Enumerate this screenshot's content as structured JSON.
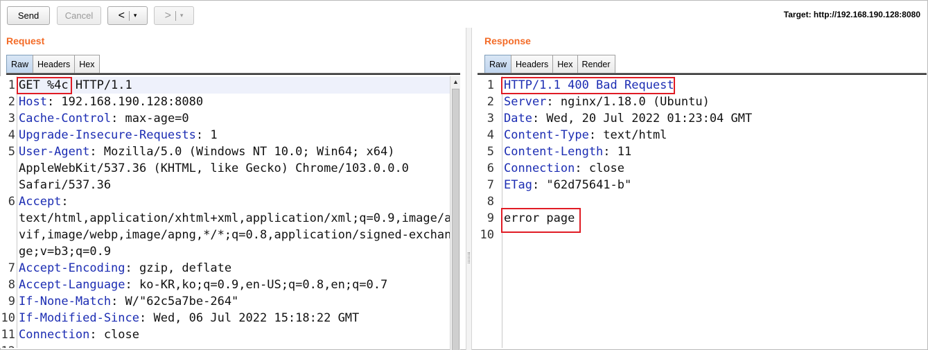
{
  "toolbar": {
    "send_label": "Send",
    "cancel_label": "Cancel",
    "back_label": "<",
    "forward_label": ">",
    "dropdown_glyph": "▾",
    "target_label": "Target: http://192.168.190.128:8080"
  },
  "request": {
    "title": "Request",
    "tabs": [
      "Raw",
      "Headers",
      "Hex"
    ],
    "active_tab": "Raw",
    "lines": [
      {
        "n": "1",
        "parts": [
          [
            "hv",
            "GET %4c HTTP/1.1"
          ]
        ]
      },
      {
        "n": "2",
        "parts": [
          [
            "hk",
            "Host"
          ],
          [
            "hv",
            ": 192.168.190.128:8080"
          ]
        ]
      },
      {
        "n": "3",
        "parts": [
          [
            "hk",
            "Cache-Control"
          ],
          [
            "hv",
            ": max-age=0"
          ]
        ]
      },
      {
        "n": "4",
        "parts": [
          [
            "hk",
            "Upgrade-Insecure-Requests"
          ],
          [
            "hv",
            ": 1"
          ]
        ]
      },
      {
        "n": "5",
        "parts": [
          [
            "hk",
            "User-Agent"
          ],
          [
            "hv",
            ": Mozilla/5.0 (Windows NT 10.0; Win64; x64)"
          ]
        ]
      },
      {
        "n": "",
        "parts": [
          [
            "hv",
            "AppleWebKit/537.36 (KHTML, like Gecko) Chrome/103.0.0.0"
          ]
        ]
      },
      {
        "n": "",
        "parts": [
          [
            "hv",
            "Safari/537.36"
          ]
        ]
      },
      {
        "n": "6",
        "parts": [
          [
            "hk",
            "Accept"
          ],
          [
            "hv",
            ":"
          ]
        ]
      },
      {
        "n": "",
        "parts": [
          [
            "hv",
            "text/html,application/xhtml+xml,application/xml;q=0.9,image/a"
          ]
        ]
      },
      {
        "n": "",
        "parts": [
          [
            "hv",
            "vif,image/webp,image/apng,*/*;q=0.8,application/signed-exchan"
          ]
        ]
      },
      {
        "n": "",
        "parts": [
          [
            "hv",
            "ge;v=b3;q=0.9"
          ]
        ]
      },
      {
        "n": "7",
        "parts": [
          [
            "hk",
            "Accept-Encoding"
          ],
          [
            "hv",
            ": gzip, deflate"
          ]
        ]
      },
      {
        "n": "8",
        "parts": [
          [
            "hk",
            "Accept-Language"
          ],
          [
            "hv",
            ": ko-KR,ko;q=0.9,en-US;q=0.8,en;q=0.7"
          ]
        ]
      },
      {
        "n": "9",
        "parts": [
          [
            "hk",
            "If-None-Match"
          ],
          [
            "hv",
            ": W/\"62c5a7be-264\""
          ]
        ]
      },
      {
        "n": "10",
        "parts": [
          [
            "hk",
            "If-Modified-Since"
          ],
          [
            "hv",
            ": Wed, 06 Jul 2022 15:18:22 GMT"
          ]
        ]
      },
      {
        "n": "11",
        "parts": [
          [
            "hk",
            "Connection"
          ],
          [
            "hv",
            ": close"
          ]
        ]
      },
      {
        "n": "12",
        "parts": [
          [
            "hv",
            ""
          ]
        ]
      }
    ]
  },
  "response": {
    "title": "Response",
    "tabs": [
      "Raw",
      "Headers",
      "Hex",
      "Render"
    ],
    "active_tab": "Raw",
    "lines": [
      {
        "n": "1",
        "parts": [
          [
            "hk",
            "HTTP/1.1 400 Bad Request"
          ]
        ]
      },
      {
        "n": "2",
        "parts": [
          [
            "hk",
            "Server"
          ],
          [
            "hv",
            ": nginx/1.18.0 (Ubuntu)"
          ]
        ]
      },
      {
        "n": "3",
        "parts": [
          [
            "hk",
            "Date"
          ],
          [
            "hv",
            ": Wed, 20 Jul 2022 01:23:04 GMT"
          ]
        ]
      },
      {
        "n": "4",
        "parts": [
          [
            "hk",
            "Content-Type"
          ],
          [
            "hv",
            ": text/html"
          ]
        ]
      },
      {
        "n": "5",
        "parts": [
          [
            "hk",
            "Content-Length"
          ],
          [
            "hv",
            ": 11"
          ]
        ]
      },
      {
        "n": "6",
        "parts": [
          [
            "hk",
            "Connection"
          ],
          [
            "hv",
            ": close"
          ]
        ]
      },
      {
        "n": "7",
        "parts": [
          [
            "hk",
            "ETag"
          ],
          [
            "hv",
            ": \"62d75641-b\""
          ]
        ]
      },
      {
        "n": "8",
        "parts": [
          [
            "hv",
            ""
          ]
        ]
      },
      {
        "n": "9",
        "parts": [
          [
            "hv",
            "error page"
          ]
        ]
      },
      {
        "n": "10",
        "parts": [
          [
            "hv",
            ""
          ]
        ]
      }
    ]
  },
  "colors": {
    "accent_title": "#f36b27",
    "header_key": "#1c2db3",
    "highlight_box": "#e01b24"
  }
}
